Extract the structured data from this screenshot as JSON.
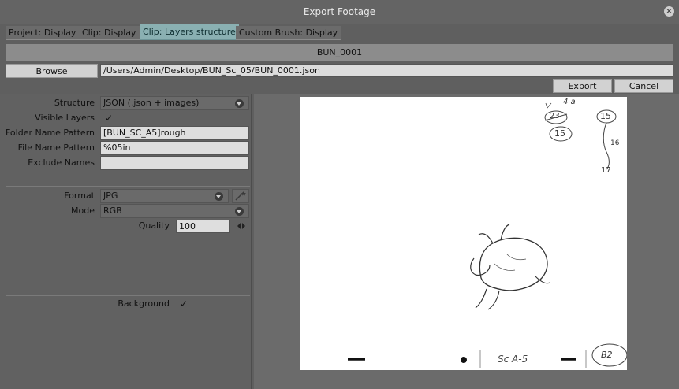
{
  "window": {
    "title": "Export Footage"
  },
  "tabs": [
    {
      "label": "Project: Display"
    },
    {
      "label": "Clip: Display"
    },
    {
      "label": "Clip: Layers structure"
    },
    {
      "label": "Custom Brush: Display"
    }
  ],
  "file": {
    "name": "BUN_0001",
    "browse_label": "Browse",
    "path": "/Users/Admin/Desktop/BUN_Sc_05/BUN_0001.json"
  },
  "actions": {
    "export_label": "Export",
    "cancel_label": "Cancel"
  },
  "settings": {
    "structure_label": "Structure",
    "structure_value": "JSON (.json + images)",
    "visible_layers_label": "Visible Layers",
    "visible_layers_checked": "✓",
    "folder_name_label": "Folder Name Pattern",
    "folder_name_value": "[BUN_SC_A5]rough",
    "file_name_label": "File Name Pattern",
    "file_name_value": "%05in",
    "exclude_names_label": "Exclude Names",
    "exclude_names_value": "",
    "format_label": "Format",
    "format_value": "JPG",
    "mode_label": "Mode",
    "mode_value": "RGB",
    "quality_label": "Quality",
    "quality_value": "100",
    "background_label": "Background",
    "background_checked": "✓"
  },
  "sketch": {
    "note_top": "4 a",
    "circle_a": "23",
    "circle_b": "15",
    "circle_c": "15",
    "side_16": "16",
    "side_17": "17",
    "scene": "Sc A-5",
    "corner": "B2"
  },
  "colors": {
    "active_tab": "#8ab0b2",
    "panel": "#616161",
    "canvas": "#ffffff"
  }
}
